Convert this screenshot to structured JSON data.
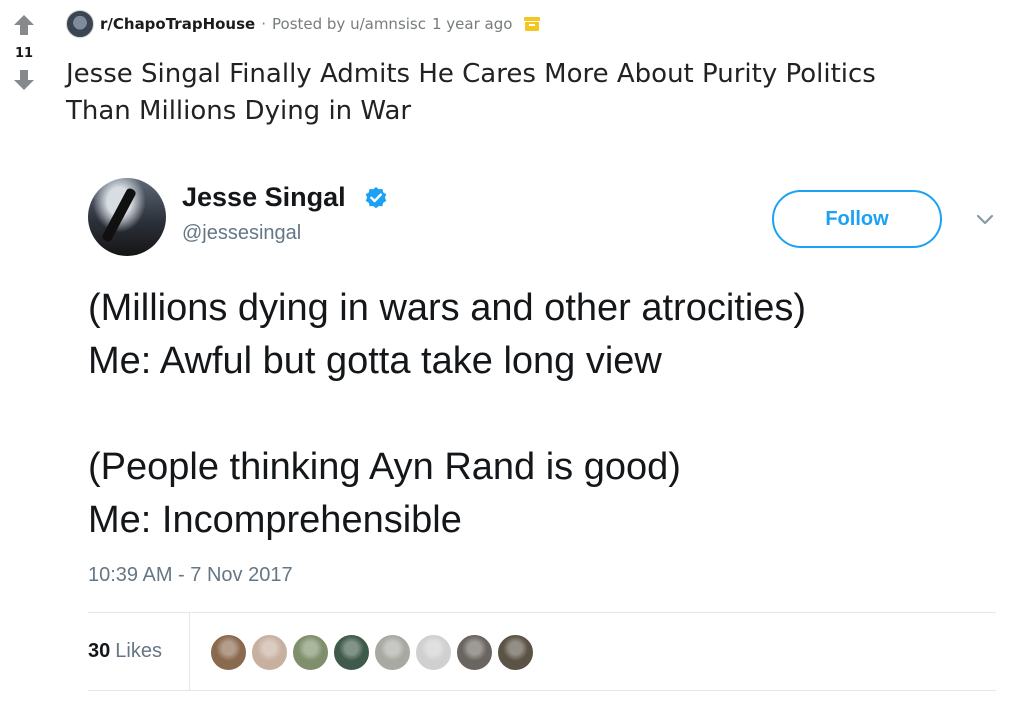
{
  "post": {
    "score": "11",
    "subreddit": "r/ChapoTrapHouse",
    "separator": "·",
    "posted_by": "Posted by u/amnsisc",
    "age": "1 year ago",
    "title_line1": "Jesse Singal Finally Admits He Cares More About Purity Politics",
    "title_line2": "Than Millions Dying in War",
    "icons": [
      "upvote-arrow-icon",
      "downvote-arrow-icon",
      "subreddit-icon",
      "archive-icon"
    ]
  },
  "tweet": {
    "author_name": "Jesse Singal",
    "handle": "@jessesingal",
    "follow_label": "Follow",
    "lines": [
      "(Millions dying in wars and other atrocities)",
      "Me: Awful but gotta take long view",
      "",
      "(People thinking Ayn Rand is good)",
      "Me: Incomprehensible"
    ],
    "timestamp": "10:39 AM - 7 Nov 2017",
    "likes_count": "30",
    "likes_label": "Likes",
    "icons": [
      "verified-badge-icon",
      "chevron-down-icon"
    ],
    "liker_colors": [
      "#8a6a4e",
      "#c7b0a0",
      "#7f8f6c",
      "#3f5a4a",
      "#a9a9a3",
      "#d0d0d0",
      "#6a6560",
      "#5b5345"
    ]
  },
  "colors": {
    "accent": "#1da1f2",
    "muted": "#657786",
    "text": "#14171a",
    "archive": "#f4c720"
  }
}
